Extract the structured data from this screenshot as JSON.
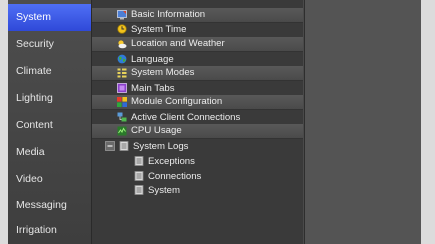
{
  "sidebar": {
    "items": [
      {
        "label": "System"
      },
      {
        "label": "Security"
      },
      {
        "label": "Climate"
      },
      {
        "label": "Lighting"
      },
      {
        "label": "Content"
      },
      {
        "label": "Media"
      },
      {
        "label": "Video"
      },
      {
        "label": "Messaging"
      },
      {
        "label": "Irrigation"
      }
    ],
    "selected_color": "#3a5be8"
  },
  "tree": {
    "items": [
      {
        "label": "Basic Information",
        "icon": "info-monitor-icon"
      },
      {
        "label": "System Time",
        "icon": "clock-icon"
      },
      {
        "label": "Location and Weather",
        "icon": "weather-icon"
      },
      {
        "label": "Language",
        "icon": "globe-icon"
      },
      {
        "label": "System Modes",
        "icon": "modes-icon"
      },
      {
        "label": "Main Tabs",
        "icon": "tabs-icon"
      },
      {
        "label": "Module Configuration",
        "icon": "module-icon"
      },
      {
        "label": "Active Client Connections",
        "icon": "connections-icon"
      },
      {
        "label": "CPU Usage",
        "icon": "cpu-icon"
      },
      {
        "label": "System Logs",
        "icon": "log-folder-icon",
        "expander": "collapse-icon"
      },
      {
        "label": "Exceptions",
        "icon": "log-file-icon"
      },
      {
        "label": "Connections",
        "icon": "log-file-icon"
      },
      {
        "label": "System",
        "icon": "log-file-icon"
      }
    ]
  }
}
